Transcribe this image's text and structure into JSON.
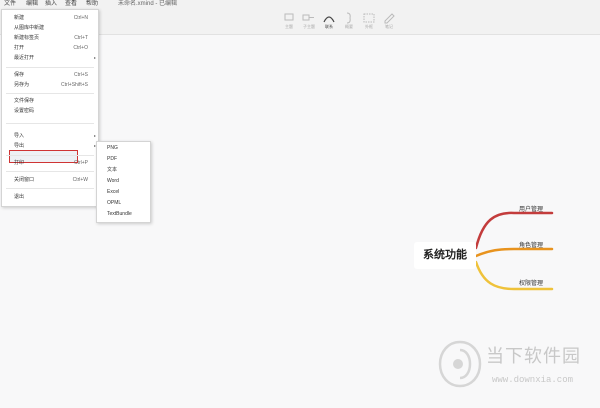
{
  "menubar": {
    "items": [
      "文件",
      "编辑",
      "插入",
      "查看",
      "帮助"
    ],
    "title": "未命名.xmind - 已编辑"
  },
  "toolbar": {
    "items": [
      {
        "label": "主题",
        "icon": "topic-icon",
        "active": false
      },
      {
        "label": "子主题",
        "icon": "subtopic-icon",
        "active": false
      },
      {
        "label": "联系",
        "icon": "relationship-icon",
        "active": true
      },
      {
        "label": "概要",
        "icon": "summary-icon",
        "active": false
      },
      {
        "label": "外框",
        "icon": "boundary-icon",
        "active": false
      },
      {
        "label": "笔记",
        "icon": "note-icon",
        "active": false
      }
    ]
  },
  "file_menu": {
    "items": [
      {
        "label": "新建",
        "shortcut": "Ctrl+N"
      },
      {
        "label": "从图库中新建",
        "shortcut": ""
      },
      {
        "label": "新建标签页",
        "shortcut": "Ctrl+T"
      },
      {
        "label": "打开",
        "shortcut": "Ctrl+O"
      },
      {
        "label": "最近打开",
        "shortcut": "▸"
      },
      {
        "label": "保存",
        "shortcut": "Ctrl+S"
      },
      {
        "label": "另存为",
        "shortcut": "Ctrl+Shift+S"
      },
      {
        "label": "文件保存",
        "shortcut": ""
      },
      {
        "label": "设置密码",
        "shortcut": ""
      },
      {
        "label": "导入",
        "shortcut": "▸"
      },
      {
        "label": "导出",
        "shortcut": "▸"
      },
      {
        "label": "打印",
        "shortcut": "Ctrl+P"
      },
      {
        "label": "关闭窗口",
        "shortcut": "Ctrl+W"
      },
      {
        "label": "退出",
        "shortcut": ""
      }
    ],
    "highlighted": "导出"
  },
  "export_submenu": {
    "items": [
      "PNG",
      "PDF",
      "文本",
      "Word",
      "Excel",
      "OPML",
      "TextBundle"
    ]
  },
  "mindmap": {
    "central": "系统功能",
    "topics": [
      "用户管理",
      "角色管理",
      "权限管理"
    ],
    "colors": {
      "top": "#c33c3c",
      "mid": "#e8931e",
      "bottom": "#efc23a"
    }
  },
  "watermark": {
    "text": "当下软件园",
    "url": "www.downxia.com"
  }
}
